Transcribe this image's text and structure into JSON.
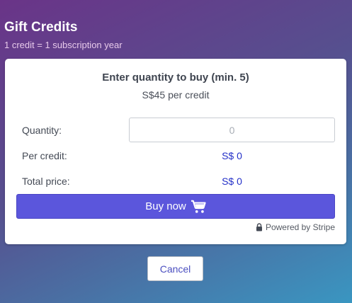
{
  "header": {
    "title": "Gift Credits",
    "subtitle": "1 credit = 1 subscription year"
  },
  "card": {
    "heading": "Enter quantity to buy (min. 5)",
    "price_line": "S$45 per credit",
    "quantity_label": "Quantity:",
    "quantity_placeholder": "0",
    "per_credit_label": "Per credit:",
    "per_credit_value": "S$ 0",
    "total_label": "Total price:",
    "total_value": "S$ 0",
    "buy_label": "Buy now",
    "powered_by": "Powered by Stripe"
  },
  "footer": {
    "cancel_label": "Cancel"
  },
  "colors": {
    "accent": "#5b56dc",
    "value_text": "#2430c8"
  },
  "icons": {
    "buy": "cart-icon",
    "powered": "lock-icon"
  }
}
